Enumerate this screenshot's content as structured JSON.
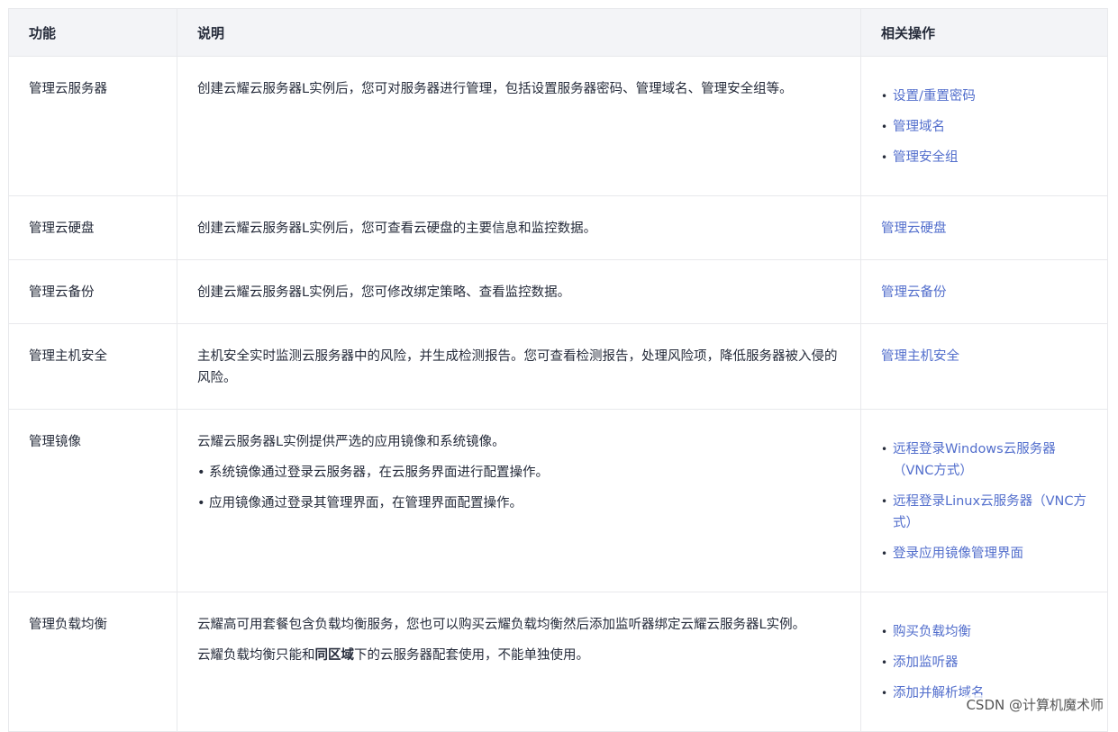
{
  "headers": [
    "功能",
    "说明",
    "相关操作"
  ],
  "rows": [
    {
      "feature": "管理云服务器",
      "desc_paragraphs": [
        "创建云耀云服务器L实例后，您可对服务器进行管理，包括设置服务器密码、管理域名、管理安全组等。"
      ],
      "desc_bullets": [],
      "ops": [
        "设置/重置密码",
        "管理域名",
        "管理安全组"
      ]
    },
    {
      "feature": "管理云硬盘",
      "desc_paragraphs": [
        "创建云耀云服务器L实例后，您可查看云硬盘的主要信息和监控数据。"
      ],
      "desc_bullets": [],
      "ops_single": "管理云硬盘"
    },
    {
      "feature": "管理云备份",
      "desc_paragraphs": [
        "创建云耀云服务器L实例后，您可修改绑定策略、查看监控数据。"
      ],
      "desc_bullets": [],
      "ops_single": "管理云备份"
    },
    {
      "feature": "管理主机安全",
      "desc_paragraphs": [
        "主机安全实时监测云服务器中的风险，并生成检测报告。您可查看检测报告，处理风险项，降低服务器被入侵的风险。"
      ],
      "desc_bullets": [],
      "ops_single": "管理主机安全"
    },
    {
      "feature": "管理镜像",
      "desc_paragraphs": [
        "云耀云服务器L实例提供严选的应用镜像和系统镜像。"
      ],
      "desc_bullets": [
        "系统镜像通过登录云服务器，在云服务界面进行配置操作。",
        "应用镜像通过登录其管理界面，在管理界面配置操作。"
      ],
      "ops": [
        "远程登录Windows云服务器（VNC方式）",
        "远程登录Linux云服务器（VNC方式）",
        "登录应用镜像管理界面"
      ]
    },
    {
      "feature": "管理负载均衡",
      "desc_paragraphs": [
        "云耀高可用套餐包含负载均衡服务，您也可以购买云耀负载均衡然后添加监听器绑定云耀云服务器L实例。"
      ],
      "desc_p2_prefix": "云耀负载均衡只能和",
      "desc_p2_bold": "同区域",
      "desc_p2_suffix": "下的云服务器配套使用，不能单独使用。",
      "desc_bullets": [],
      "ops": [
        "购买负载均衡",
        "添加监听器",
        "添加并解析域名"
      ]
    }
  ],
  "watermark": "CSDN @计算机魔术师",
  "colors": {
    "link": "#526ecc",
    "header_bg": "#f3f4f7",
    "border": "#e8e9ec",
    "text": "#252b3a"
  }
}
